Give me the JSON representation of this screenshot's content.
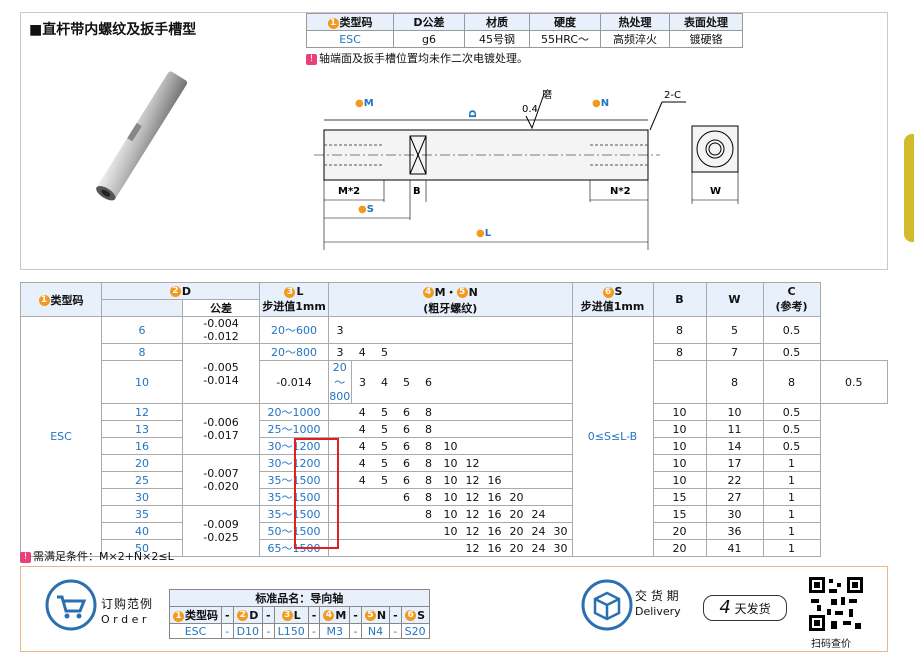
{
  "title": "■直杆带内螺纹及扳手槽型",
  "spec": {
    "headers": [
      "类型码",
      "D公差",
      "材质",
      "硬度",
      "热处理",
      "表面处理"
    ],
    "header_nums": [
      "1",
      "",
      "",
      "",
      "",
      ""
    ],
    "row": [
      "ESC",
      "g6",
      "45号钢",
      "55HRC～",
      "高频淬火",
      "镀硬铬"
    ]
  },
  "note": "轴端面及扳手槽位置均未作二次电镀处理。",
  "note_tag": "!",
  "drawing": {
    "m_label": "M",
    "d_label": "D",
    "grind_label": "磨",
    "grind_value": "0.4",
    "n_label": "N",
    "c_label": "2-C",
    "mx2": "M*2",
    "b": "B",
    "nx2": "N*2",
    "s": "S",
    "l": "L",
    "w": "W",
    "n4": "4",
    "n2": "2",
    "n5": "5",
    "n6": "6",
    "n3": "3"
  },
  "table": {
    "h_type": "类型码",
    "h_d": "D",
    "h_tol": "公差",
    "h_l": "L",
    "h_l_sub": "步进值1mm",
    "h_mn": "M・",
    "h_mn2": "N",
    "h_mn_sub": "(粗牙螺纹)",
    "h_s": "S",
    "h_s_sub": "步进值1mm",
    "h_b": "B",
    "h_w": "W",
    "h_c": "C",
    "h_c_sub": "(参考)",
    "type": "ESC",
    "s_range": "0≤S≤L-B",
    "rows": [
      {
        "d": "6",
        "tol": "-0.004\n-0.012",
        "l": "20～600",
        "m": [
          "3",
          "",
          "",
          "",
          "",
          "",
          "",
          "",
          "",
          ""
        ],
        "b": "8",
        "w": "5",
        "c": "0.5"
      },
      {
        "d": "8",
        "tol": "-0.005",
        "l": "20～800",
        "m": [
          "3",
          "4",
          "5",
          "",
          "",
          "",
          "",
          "",
          "",
          ""
        ],
        "b": "8",
        "w": "7",
        "c": "0.5"
      },
      {
        "d": "10",
        "tol": "-0.014",
        "l": "20～800",
        "m": [
          "3",
          "4",
          "5",
          "6",
          "",
          "",
          "",
          "",
          "",
          ""
        ],
        "b": "8",
        "w": "8",
        "c": "0.5"
      },
      {
        "d": "12",
        "tol": "",
        "l": "20～1000",
        "m": [
          "",
          "4",
          "5",
          "6",
          "8",
          "",
          "",
          "",
          "",
          ""
        ],
        "b": "10",
        "w": "10",
        "c": "0.5"
      },
      {
        "d": "13",
        "tol": "-0.006\n-0.017",
        "l": "25～1000",
        "m": [
          "",
          "4",
          "5",
          "6",
          "8",
          "",
          "",
          "",
          "",
          ""
        ],
        "b": "10",
        "w": "11",
        "c": "0.5"
      },
      {
        "d": "16",
        "tol": "",
        "l": "30～1200",
        "m": [
          "",
          "4",
          "5",
          "6",
          "8",
          "10",
          "",
          "",
          "",
          ""
        ],
        "b": "10",
        "w": "14",
        "c": "0.5"
      },
      {
        "d": "20",
        "tol": "",
        "l": "30～1200",
        "m": [
          "",
          "4",
          "5",
          "6",
          "8",
          "10",
          "12",
          "",
          "",
          ""
        ],
        "b": "10",
        "w": "17",
        "c": "1"
      },
      {
        "d": "25",
        "tol": "-0.007\n-0.020",
        "l": "35～1500",
        "m": [
          "",
          "4",
          "5",
          "6",
          "8",
          "10",
          "12",
          "16",
          "",
          ""
        ],
        "b": "10",
        "w": "22",
        "c": "1"
      },
      {
        "d": "30",
        "tol": "",
        "l": "35～1500",
        "m": [
          "",
          "",
          "",
          "6",
          "8",
          "10",
          "12",
          "16",
          "20",
          ""
        ],
        "b": "15",
        "w": "27",
        "c": "1"
      },
      {
        "d": "35",
        "tol": "",
        "l": "35～1500",
        "m": [
          "",
          "",
          "",
          "",
          "8",
          "10",
          "12",
          "16",
          "20",
          "24"
        ],
        "b": "15",
        "w": "30",
        "c": "1"
      },
      {
        "d": "40",
        "tol": "-0.009\n-0.025",
        "l": "50～1500",
        "m": [
          "",
          "",
          "",
          "",
          "",
          "10",
          "12",
          "16",
          "20",
          "24",
          "30"
        ],
        "b": "20",
        "w": "36",
        "c": "1"
      },
      {
        "d": "50",
        "tol": "",
        "l": "65～1500",
        "m": [
          "",
          "",
          "",
          "",
          "",
          "",
          "12",
          "16",
          "20",
          "24",
          "30"
        ],
        "b": "20",
        "w": "41",
        "c": "1"
      }
    ]
  },
  "condition": "需满足条件：M×2+N×2≤L",
  "order": {
    "label_cn": "订购范例",
    "label_en": "O r d e r",
    "std_name": "标准品名：导向轴",
    "cols": [
      "类型码",
      "-",
      "D",
      "-",
      "L",
      "-",
      "M",
      "-",
      "N",
      "-",
      "S"
    ],
    "vals": [
      "ESC",
      "-",
      "D10",
      "-",
      "L150",
      "-",
      "M3",
      "-",
      "N4",
      "-",
      "S20"
    ],
    "delivery_cn": "交 货 期",
    "delivery_en": "Delivery",
    "days": "4",
    "days_label": "天发货",
    "qr_label": "扫码查价"
  },
  "colors": {
    "accent": "#f39a1e",
    "blue": "#2275c0",
    "header_bg": "#e8f0fb",
    "red": "#e02020"
  }
}
